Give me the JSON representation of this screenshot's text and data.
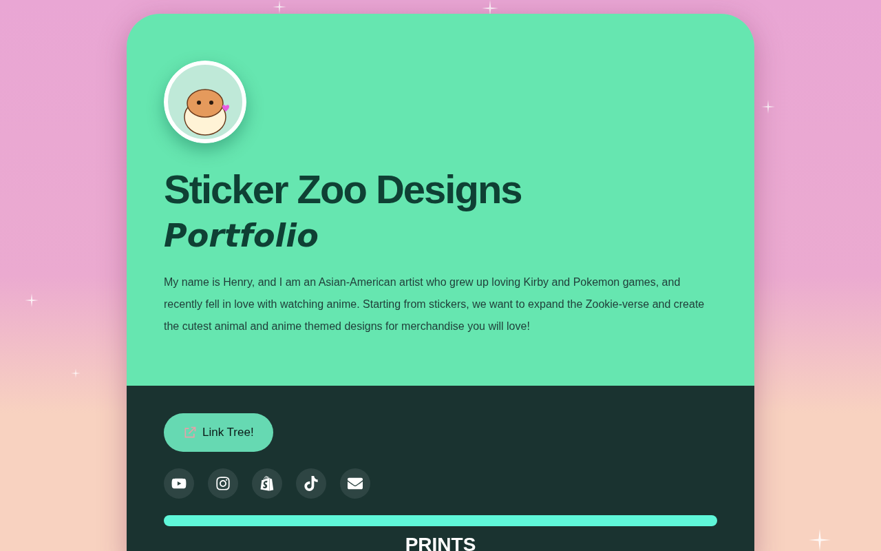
{
  "profile": {
    "title": "Sticker Zoo Designs",
    "subtitle": "Portfolio",
    "bio": "My name is Henry, and I am an Asian-American artist who grew up loving Kirby and Pokemon games, and recently fell in love with watching anime. Starting from stickers, we want to expand the Zookie-verse and create the cutest animal and anime themed designs for merchandise you will love!"
  },
  "link_button": {
    "label": "Link Tree!"
  },
  "socials": [
    {
      "kind": "youtube"
    },
    {
      "kind": "instagram"
    },
    {
      "kind": "shop"
    },
    {
      "kind": "tiktok"
    },
    {
      "kind": "email"
    }
  ],
  "section": {
    "heading": "PRINTS"
  }
}
